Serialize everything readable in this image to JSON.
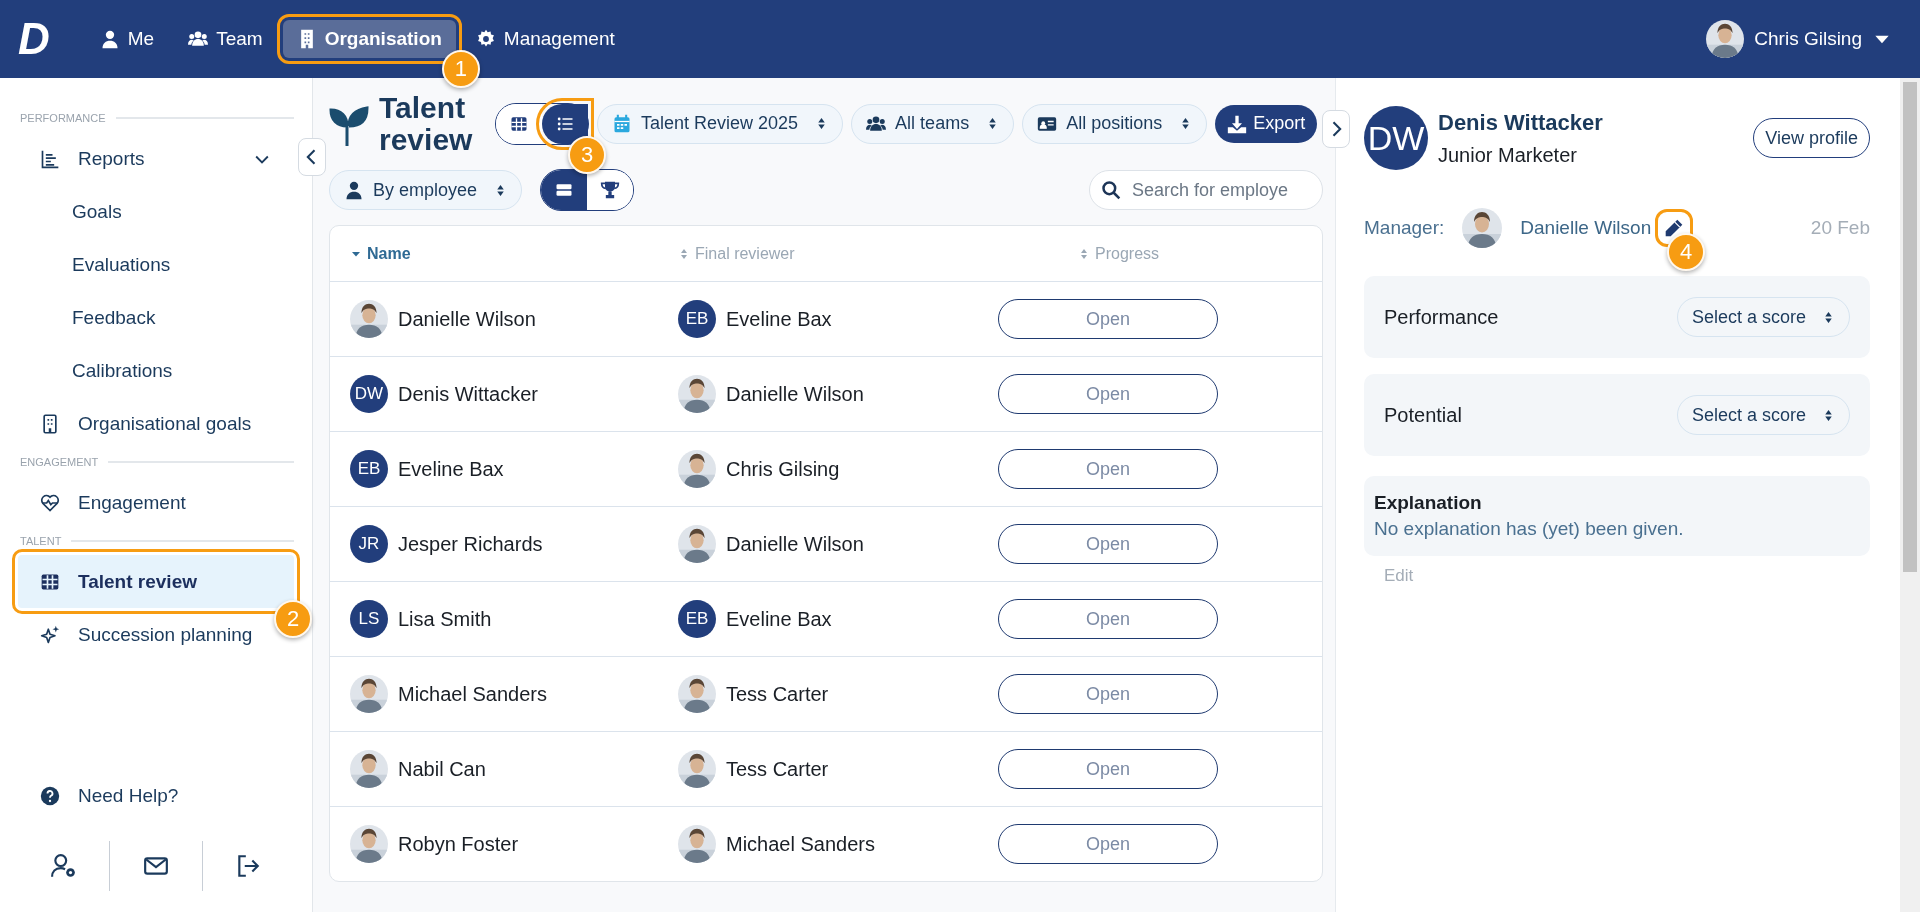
{
  "topbar": {
    "logo": "D",
    "nav": [
      {
        "label": "Me",
        "kind": "user",
        "selected": false
      },
      {
        "label": "Team",
        "kind": "users",
        "selected": false
      },
      {
        "label": "Organisation",
        "kind": "building",
        "selected": true,
        "callout": "1"
      },
      {
        "label": "Management",
        "kind": "gear",
        "selected": false
      }
    ],
    "user": {
      "name": "Chris Gilsing"
    }
  },
  "sidebar": {
    "sections": [
      {
        "title": "PERFORMANCE",
        "items": [
          {
            "label": "Reports",
            "kind": "chart",
            "selected": false,
            "expanded": true,
            "children": [
              {
                "label": "Goals",
                "selected": false
              },
              {
                "label": "Evaluations",
                "selected": false
              },
              {
                "label": "Feedback",
                "selected": false
              },
              {
                "label": "Calibrations",
                "selected": false
              }
            ]
          },
          {
            "label": "Organisational goals",
            "kind": "building",
            "selected": false
          }
        ]
      },
      {
        "title": "ENGAGEMENT",
        "items": [
          {
            "label": "Engagement",
            "kind": "heart",
            "selected": false
          }
        ]
      },
      {
        "title": "TALENT",
        "items": [
          {
            "label": "Talent review",
            "kind": "table",
            "selected": true,
            "callout": "2"
          },
          {
            "label": "Succession planning",
            "kind": "sparkles",
            "selected": false
          }
        ]
      }
    ],
    "help": "Need Help?"
  },
  "page": {
    "title": "Talent review",
    "view_toggle": [
      {
        "kind": "grid",
        "selected": false
      },
      {
        "kind": "list",
        "selected": true,
        "callout": "3"
      }
    ],
    "filters": [
      {
        "label": "Talent Review 2025",
        "kind": "calendar"
      },
      {
        "label": "All teams",
        "kind": "users"
      },
      {
        "label": "All positions",
        "kind": "idcard"
      }
    ],
    "export": "Export",
    "group_by": "By employee",
    "mode_toggle": [
      {
        "kind": "rows",
        "selected": true
      },
      {
        "kind": "trophy",
        "selected": false
      }
    ],
    "search": {
      "placeholder": "Search for employe"
    }
  },
  "table": {
    "columns": [
      {
        "label": "Name",
        "sorted": true
      },
      {
        "label": "Final reviewer",
        "sorted": false
      },
      {
        "label": "Progress",
        "sorted": false
      }
    ],
    "rows": [
      {
        "name": "Danielle Wilson",
        "reviewer": "Eveline Bax",
        "reviewer_avatar": {
          "kind": "initials",
          "initials": "EB"
        },
        "progress": "Open"
      },
      {
        "name": "Denis Wittacker",
        "avatar": {
          "kind": "initials",
          "initials": "DW"
        },
        "reviewer": "Danielle Wilson",
        "progress": "Open"
      },
      {
        "name": "Eveline Bax",
        "avatar": {
          "kind": "initials",
          "initials": "EB"
        },
        "reviewer": "Chris Gilsing",
        "progress": "Open"
      },
      {
        "name": "Jesper Richards",
        "avatar": {
          "kind": "initials",
          "initials": "JR"
        },
        "reviewer": "Danielle Wilson",
        "progress": "Open"
      },
      {
        "name": "Lisa Smith",
        "avatar": {
          "kind": "initials",
          "initials": "LS"
        },
        "reviewer": "Eveline Bax",
        "reviewer_avatar": {
          "kind": "initials",
          "initials": "EB"
        },
        "progress": "Open"
      },
      {
        "name": "Michael Sanders",
        "reviewer": "Tess Carter",
        "progress": "Open"
      },
      {
        "name": "Nabil Can",
        "reviewer": "Tess Carter",
        "progress": "Open"
      },
      {
        "name": "Robyn Foster",
        "reviewer": "Michael Sanders",
        "progress": "Open"
      }
    ]
  },
  "details": {
    "initials": "DW",
    "name": "Denis Wittacker",
    "role": "Junior Marketer",
    "view_profile": "View profile",
    "manager_label": "Manager:",
    "manager": "Danielle Wilson",
    "edit_callout": "4",
    "date": "20 Feb",
    "scores": [
      {
        "label": "Performance",
        "select": "Select a score"
      },
      {
        "label": "Potential",
        "select": "Select a score"
      }
    ],
    "explanation": {
      "title": "Explanation",
      "text": "No explanation has (yet) been given."
    },
    "edit": "Edit"
  }
}
